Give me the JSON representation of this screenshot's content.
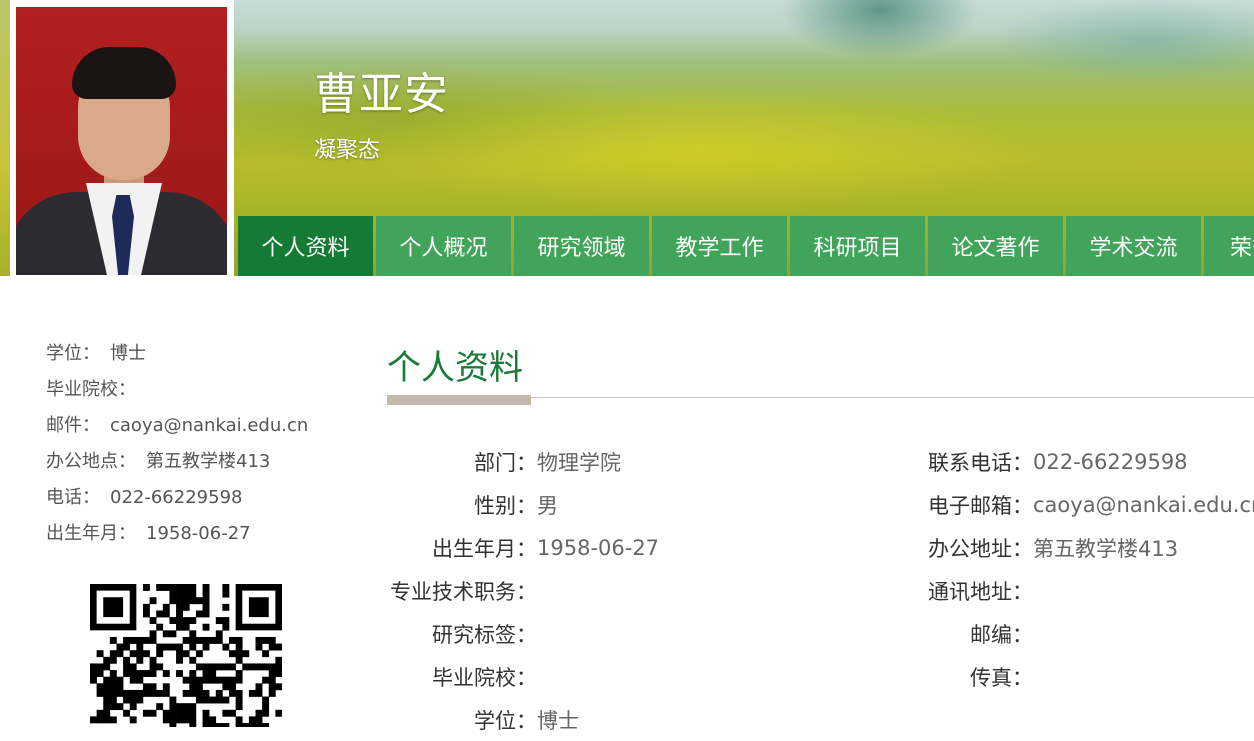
{
  "header": {
    "name": "曹亚安",
    "subtitle": "凝聚态"
  },
  "nav": {
    "items": [
      {
        "label": "个人资料",
        "active": true
      },
      {
        "label": "个人概况",
        "active": false
      },
      {
        "label": "研究领域",
        "active": false
      },
      {
        "label": "教学工作",
        "active": false
      },
      {
        "label": "科研项目",
        "active": false
      },
      {
        "label": "论文著作",
        "active": false
      },
      {
        "label": "学术交流",
        "active": false
      },
      {
        "label": "荣誉",
        "active": false
      }
    ]
  },
  "sidebar": {
    "rows": [
      {
        "label": "学位：",
        "value": "博士"
      },
      {
        "label": "毕业院校：",
        "value": ""
      },
      {
        "label": "邮件：",
        "value": "caoya@nankai.edu.cn"
      },
      {
        "label": "办公地点：",
        "value": "第五教学楼413"
      },
      {
        "label": "电话：",
        "value": "022-66229598"
      },
      {
        "label": "出生年月：",
        "value": "1958-06-27"
      }
    ]
  },
  "main": {
    "section_title": "个人资料",
    "left_details": [
      {
        "label": "部门：",
        "value": "物理学院"
      },
      {
        "label": "性别：",
        "value": "男"
      },
      {
        "label": "出生年月：",
        "value": "1958-06-27"
      },
      {
        "label": "专业技术职务：",
        "value": ""
      },
      {
        "label": "研究标签：",
        "value": ""
      },
      {
        "label": "毕业院校：",
        "value": ""
      },
      {
        "label": "学位：",
        "value": "博士"
      }
    ],
    "right_details": [
      {
        "label": "联系电话：",
        "value": "022-66229598"
      },
      {
        "label": "电子邮箱：",
        "value": "caoya@nankai.edu.cn"
      },
      {
        "label": "办公地址：",
        "value": "第五教学楼413"
      },
      {
        "label": "通讯地址：",
        "value": ""
      },
      {
        "label": "邮编：",
        "value": ""
      },
      {
        "label": "传真：",
        "value": ""
      }
    ]
  },
  "colors": {
    "nav_bg": "#41a45a",
    "nav_active": "#157a35",
    "title_green": "#1a7a3a"
  }
}
